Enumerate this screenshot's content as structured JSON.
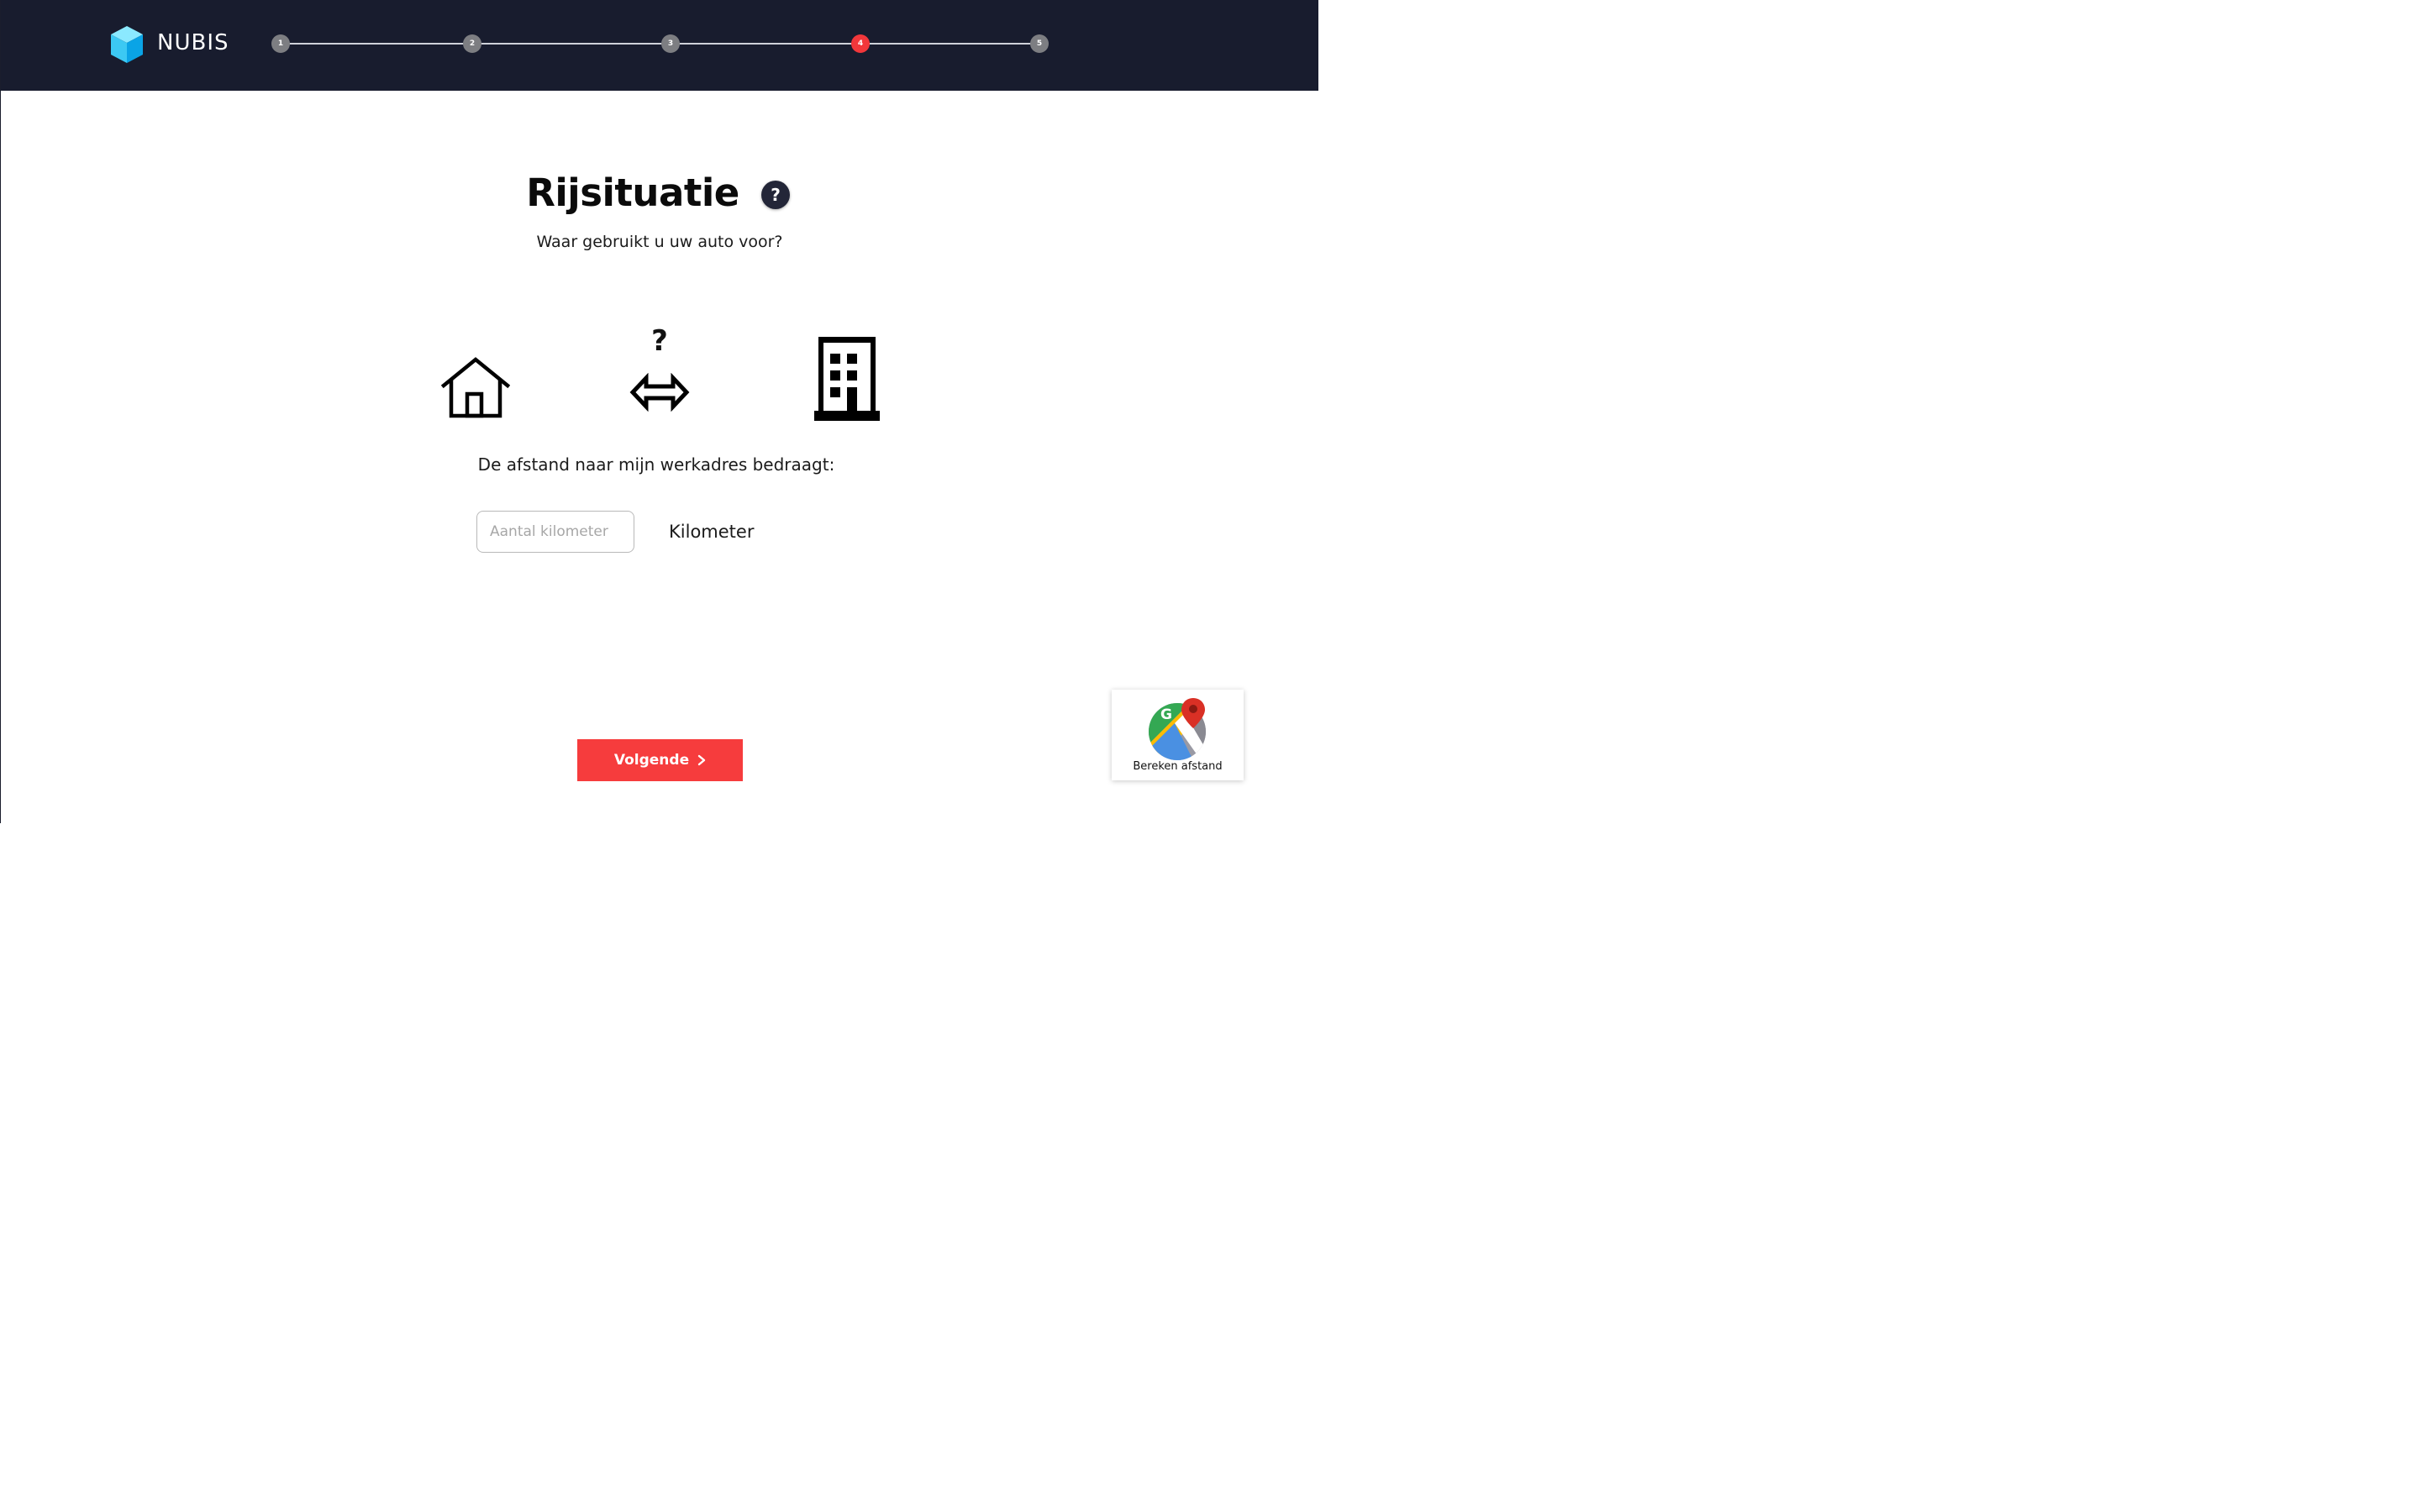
{
  "brand": {
    "name": "NUBIS"
  },
  "progress": {
    "steps": [
      {
        "label": "1",
        "state": "default"
      },
      {
        "label": "2",
        "state": "default"
      },
      {
        "label": "3",
        "state": "default"
      },
      {
        "label": "4",
        "state": "active"
      },
      {
        "label": "5",
        "state": "default"
      }
    ],
    "current_step": 4,
    "total_steps": 5
  },
  "page": {
    "title": "Rijsituatie",
    "help_icon": "?",
    "subtitle": "Waar gebruikt u uw auto voor?"
  },
  "illustration": {
    "home_icon": "home-icon",
    "commute_icon": "double-arrow-question-icon",
    "commute_question": "?",
    "office_icon": "office-building-icon"
  },
  "distance": {
    "label": "De afstand naar mijn werkadres bedraagt:",
    "input_placeholder": "Aantal kilometer",
    "input_value": "",
    "unit": "Kilometer"
  },
  "next_button": {
    "label": "Volgende",
    "icon": "chevron-right-icon"
  },
  "maps_widget": {
    "label": "Bereken afstand",
    "icon": "google-maps-icon"
  },
  "colors": {
    "header_bg": "#181c2e",
    "accent": "#f63c3d",
    "step_default": "#7d7e82",
    "step_active": "#f2373b",
    "logo_cube": "#29c6f2"
  }
}
